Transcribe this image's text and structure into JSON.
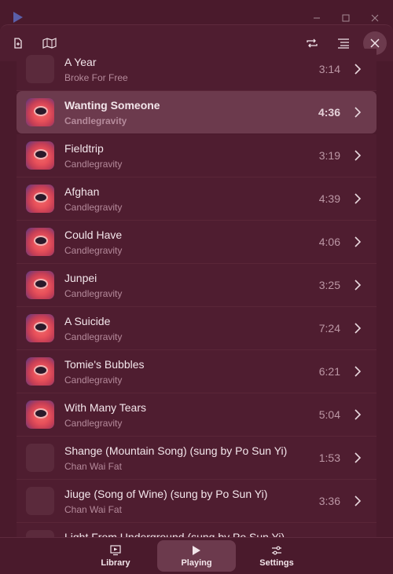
{
  "window": {
    "controls": {
      "minimize_icon": "minimize-icon",
      "maximize_icon": "maximize-icon",
      "close_icon": "close-icon"
    }
  },
  "toolbar": {
    "left_icons": [
      "open-file-icon",
      "map-icon"
    ],
    "right_icons": [
      "repeat-icon",
      "playlist-icon",
      "close-icon"
    ]
  },
  "playlist": [
    {
      "title": "A Year",
      "artist": "Broke For Free",
      "duration": "3:14",
      "has_art": false
    },
    {
      "title": "Wanting Someone",
      "artist": "Candlegravity",
      "duration": "4:36",
      "has_art": true,
      "selected": true
    },
    {
      "title": "Fieldtrip",
      "artist": "Candlegravity",
      "duration": "3:19",
      "has_art": true
    },
    {
      "title": "Afghan",
      "artist": "Candlegravity",
      "duration": "4:39",
      "has_art": true
    },
    {
      "title": "Could Have",
      "artist": "Candlegravity",
      "duration": "4:06",
      "has_art": true
    },
    {
      "title": "Junpei",
      "artist": "Candlegravity",
      "duration": "3:25",
      "has_art": true
    },
    {
      "title": "A Suicide",
      "artist": "Candlegravity",
      "duration": "7:24",
      "has_art": true
    },
    {
      "title": "Tomie's Bubbles",
      "artist": "Candlegravity",
      "duration": "6:21",
      "has_art": true
    },
    {
      "title": "With Many Tears",
      "artist": "Candlegravity",
      "duration": "5:04",
      "has_art": true
    },
    {
      "title": "Shange (Mountain Song) (sung by Po Sun Yi)",
      "artist": "Chan Wai Fat",
      "duration": "1:53",
      "has_art": false
    },
    {
      "title": "Jiuge (Song of Wine) (sung by Po Sun Yi)",
      "artist": "Chan Wai Fat",
      "duration": "3:36",
      "has_art": false
    },
    {
      "title": "Light From Underground (sung by Po Sun Yi)",
      "artist": "",
      "duration": "",
      "has_art": false
    }
  ],
  "nav": {
    "library": "Library",
    "playing": "Playing",
    "settings": "Settings",
    "active": "playing"
  },
  "colors": {
    "background": "#4a1a2c",
    "row": "#4f1d30",
    "selected_row": "#6c3a4d",
    "text": "#f3e6eb",
    "muted_text": "#b58a9b"
  }
}
